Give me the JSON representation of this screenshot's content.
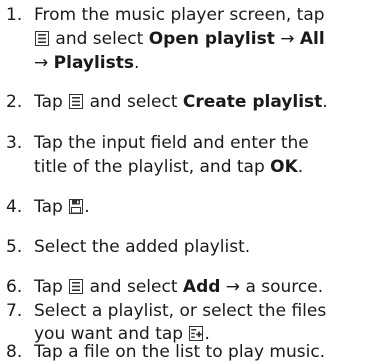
{
  "icons": {
    "menu": "menu-icon",
    "save": "save-icon",
    "add": "add-icon"
  },
  "steps": [
    {
      "number": "1.",
      "line1_pre": "From the music player screen, tap",
      "line2_pre": " and select ",
      "line2_bold": "Open playlist",
      "line2_arrow": " → ",
      "line2_bold2": "All",
      "line3_arrow": "→ ",
      "line3_bold": "Playlists",
      "line3_post": "."
    },
    {
      "number": "2.",
      "pre": "Tap ",
      "mid": " and select ",
      "bold": "Create playlist",
      "post": "."
    },
    {
      "number": "3.",
      "line1": "Tap the input field and enter the",
      "line2_pre": "title of the playlist, and tap ",
      "line2_bold": "OK",
      "line2_post": "."
    },
    {
      "number": "4.",
      "pre": "Tap ",
      "post": "."
    },
    {
      "number": "5.",
      "text": "Select the added playlist."
    },
    {
      "number": "6.",
      "pre": "Tap ",
      "mid": " and select ",
      "bold": "Add",
      "post": " → a source."
    },
    {
      "number": "7.",
      "line1": "Select a playlist, or select the files",
      "line2_pre": "you want and tap ",
      "line2_post": "."
    },
    {
      "number": "8.",
      "text": "Tap a file on the list to play music."
    }
  ]
}
